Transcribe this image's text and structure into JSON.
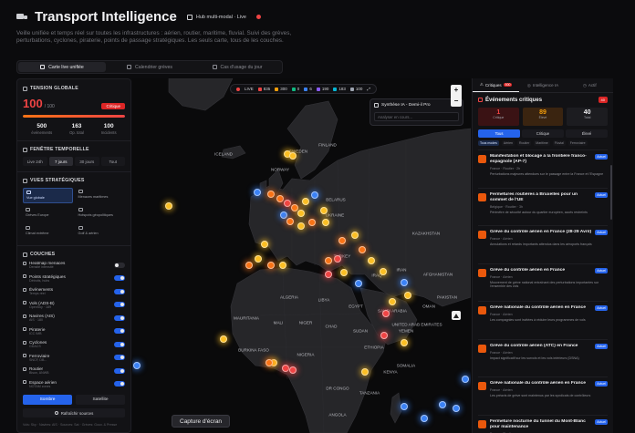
{
  "header": {
    "title": "Transport Intelligence",
    "hub_label": "Hub multi-modal · Live",
    "description": "Veille unifiée et temps réel sur toutes les infrastructures : aérien, routier, maritime, fluvial. Suivi des grèves, perturbations, cyclones, piraterie, points de passage stratégiques. Les seuls carte, tous de les couches."
  },
  "tabs": [
    {
      "label": "Carte live unifiée",
      "icon": "map-icon"
    },
    {
      "label": "Calendrier grèves",
      "icon": "calendar-icon"
    },
    {
      "label": "Cas d'usage du jour",
      "icon": "lightbulb-icon"
    }
  ],
  "tension": {
    "title": "TENSION GLOBALE",
    "value": "100",
    "max": "/ 100",
    "level": "Critique",
    "fill_percent": 100,
    "stats": [
      {
        "value": "500",
        "label": "événements"
      },
      {
        "value": "163",
        "label": "Op. total"
      },
      {
        "value": "100",
        "label": "Incidents"
      }
    ]
  },
  "temporal": {
    "title": "FENÊTRE TEMPORELLE",
    "options": [
      "Live 24h",
      "7 jours",
      "30 jours",
      "Tout"
    ],
    "active_index": 1
  },
  "views": {
    "title": "VUES STRATÉGIQUES",
    "items": [
      {
        "label": "Vue globale",
        "active": true
      },
      {
        "label": "Menaces maritimes",
        "active": false
      },
      {
        "label": "Grèves Europe",
        "active": false
      },
      {
        "label": "Hotspots géopolitiques",
        "active": false
      },
      {
        "label": "Climat extrême",
        "active": false
      },
      {
        "label": "Golf & aérien",
        "active": false
      }
    ]
  },
  "layers": {
    "title": "COUCHES",
    "items": [
      {
        "name": "Heatmap menaces",
        "sub": "Densité intensité",
        "on": false
      },
      {
        "name": "Points stratégiques",
        "sub": "Détroits, hubs",
        "on": true
      },
      {
        "name": "Événements",
        "sub": "Temps réel",
        "on": true
      },
      {
        "name": "Vols (ADS-B)",
        "sub": "OpenSky · 189",
        "on": true
      },
      {
        "name": "Navires (AIS)",
        "sub": "AIS · 180",
        "on": true
      },
      {
        "name": "Piraterie",
        "sub": "ICC IMB",
        "on": true
      },
      {
        "name": "Cyclones",
        "sub": "GDACS",
        "on": true
      },
      {
        "name": "Ferroviaire",
        "sub": "SNCF, DB...",
        "on": true
      },
      {
        "name": "Routier",
        "sub": "Bison, ANWB",
        "on": true
      },
      {
        "name": "Espace aérien",
        "sub": "NOTAM zones",
        "on": true
      }
    ]
  },
  "mode": {
    "options": [
      "Sombre",
      "Satellite"
    ],
    "active_index": 0
  },
  "refresh_label": "Rafraîchir sources",
  "footer_note": "Vols: Sky · Navires: AIS · Sources: Sat · Grèves: Gouv. & Presse",
  "map": {
    "live_label": "LIVE",
    "counters": [
      {
        "value": "835",
        "color": "#ef4444"
      },
      {
        "value": "300",
        "color": "#f59e0b"
      },
      {
        "value": "0",
        "color": "#10b981"
      },
      {
        "value": "6",
        "color": "#3b82f6"
      },
      {
        "value": "190",
        "color": "#8b5cf6"
      },
      {
        "value": "183",
        "color": "#06b6d4"
      },
      {
        "value": "100",
        "color": "#9ca3af"
      }
    ],
    "ai_title": "Synthèse IA - Demi-il Pro",
    "ai_placeholder": "Analyser en cours...",
    "zoom_in": "+",
    "zoom_out": "−",
    "capture_label": "Capture d'écran",
    "labels": [
      {
        "text": "ICELAND"
      },
      {
        "text": "SWEDEN"
      },
      {
        "text": "FINLAND"
      },
      {
        "text": "NORWAY"
      },
      {
        "text": "BELARUS"
      },
      {
        "text": "UKRAINE"
      },
      {
        "text": "KAZAKHSTAN"
      },
      {
        "text": "TURKEY"
      },
      {
        "text": "IRAN"
      },
      {
        "text": "IRAQ"
      },
      {
        "text": "AFGHANISTAN"
      },
      {
        "text": "PAKISTAN"
      },
      {
        "text": "ALGERIA"
      },
      {
        "text": "LIBYA"
      },
      {
        "text": "EGYPT"
      },
      {
        "text": "SAUDI ARABIA"
      },
      {
        "text": "MAURITANIA"
      },
      {
        "text": "MALI"
      },
      {
        "text": "NIGER"
      },
      {
        "text": "CHAD"
      },
      {
        "text": "SUDAN"
      },
      {
        "text": "NIGERIA"
      },
      {
        "text": "ETHIOPIA"
      },
      {
        "text": "YEMEN"
      },
      {
        "text": "DR CONGO"
      },
      {
        "text": "TANZANIA"
      },
      {
        "text": "ANGOLA"
      },
      {
        "text": "KENYA"
      },
      {
        "text": "SOMALIA"
      },
      {
        "text": "UNITED ARAB EMIRATES"
      },
      {
        "text": "OMAN"
      },
      {
        "text": "BURKINA FASO"
      }
    ]
  },
  "right_panel": {
    "tabs": [
      {
        "label": "Critiques",
        "count": "500",
        "active": true
      },
      {
        "label": "Intelligence IA",
        "count": "",
        "active": false
      },
      {
        "label": "Actif",
        "count": "",
        "active": false
      }
    ],
    "events_title": "Événements critiques",
    "events_total": "40",
    "severity": [
      {
        "value": "1",
        "label": "Critique",
        "style": "red"
      },
      {
        "value": "89",
        "label": "Élevé",
        "style": "orange"
      },
      {
        "value": "40",
        "label": "Total",
        "style": "gray"
      }
    ],
    "filters": [
      "Tous",
      "Critique",
      "Élevé"
    ],
    "filter_active": 0,
    "categories": [
      "Tous modes",
      "Aérien",
      "Routier",
      "Maritime",
      "Fluvial",
      "Ferroviaire"
    ],
    "events": [
      {
        "title": "Manifestation et blocage à la frontière franco-espagnole (AP-7)",
        "badge": "Actuel",
        "meta": "France · Routier · 2h",
        "text": "Perturbations majeures attendues sur le passage entre la France et l'Espagne",
        "icon_style": "orange"
      },
      {
        "title": "Fermetures routières à Bruxelles pour un sommet de l'UE",
        "badge": "Actuel",
        "meta": "Belgique · Routier · 3h",
        "text": "Périmètre de sécurité autour du quartier européen, accès restreints",
        "icon_style": "orange"
      },
      {
        "title": "Grève du contrôle aérien en France (28-29 Avril)",
        "badge": "Actuel",
        "meta": "France · Aérien",
        "text": "Annulations et retards importants attendus dans les aéroports français",
        "icon_style": "orange"
      },
      {
        "title": "Grève du contrôle aérien en France",
        "badge": "Actuel",
        "meta": "France · Aérien",
        "text": "Mouvement de grève national entraînant des perturbations importantes sur l'ensemble des vols",
        "icon_style": "orange"
      },
      {
        "title": "Grève nationale du contrôle aérien en France",
        "badge": "Actuel",
        "meta": "France · Aérien",
        "text": "Les compagnies sont invitées à réduire leurs programmes de vols",
        "icon_style": "orange"
      },
      {
        "title": "Grève du contrôle aérien (ATC) en France",
        "badge": "Actuel",
        "meta": "France · Aérien",
        "text": "Impact significatif sur les survols et les vols intérieurs (DSNA)",
        "icon_style": "orange"
      },
      {
        "title": "Grève nationale du contrôle aérien en France",
        "badge": "Actuel",
        "meta": "France · Aérien",
        "text": "Les préavis de grève sont maintenus par les syndicats de contrôleurs",
        "icon_style": "orange"
      },
      {
        "title": "Fermeture nocturne du tunnel du Mont-Blanc pour maintenance",
        "badge": "Actuel",
        "meta": "France · Routier",
        "text": "",
        "icon_style": "orange"
      }
    ]
  }
}
